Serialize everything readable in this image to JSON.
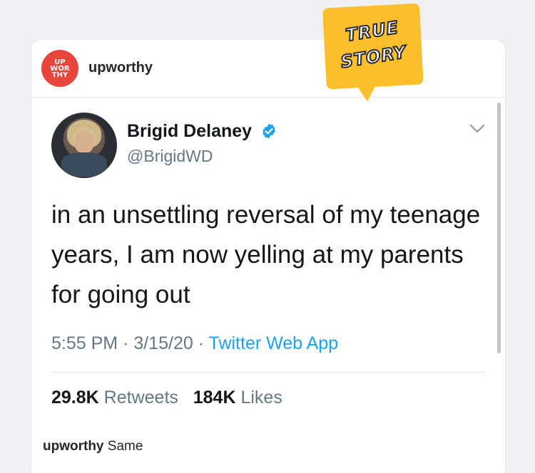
{
  "post": {
    "account": "upworthy",
    "logo_lines": [
      "UP",
      "WOR",
      "THY"
    ],
    "sticker_lines": [
      "TRUE",
      "STORY"
    ],
    "caption_user": "upworthy",
    "caption_text": "Same"
  },
  "tweet": {
    "display_name": "Brigid Delaney",
    "handle": "@BrigidWD",
    "text": "in an unsettling reversal of my teenage years, I am now yelling at my parents for going out",
    "time": "5:55 PM",
    "date": "3/15/20",
    "source": "Twitter Web App",
    "separator": "·",
    "retweets_count": "29.8K",
    "retweets_label": "Retweets",
    "likes_count": "184K",
    "likes_label": "Likes"
  },
  "colors": {
    "logo_red": "#e8453c",
    "sticker_yellow": "#fbbf2e",
    "twitter_blue": "#1da1f2",
    "muted_text": "#657786",
    "verified_blue": "#1da1f2"
  },
  "icons": [
    "verified-badge-icon",
    "chevron-down-icon"
  ]
}
